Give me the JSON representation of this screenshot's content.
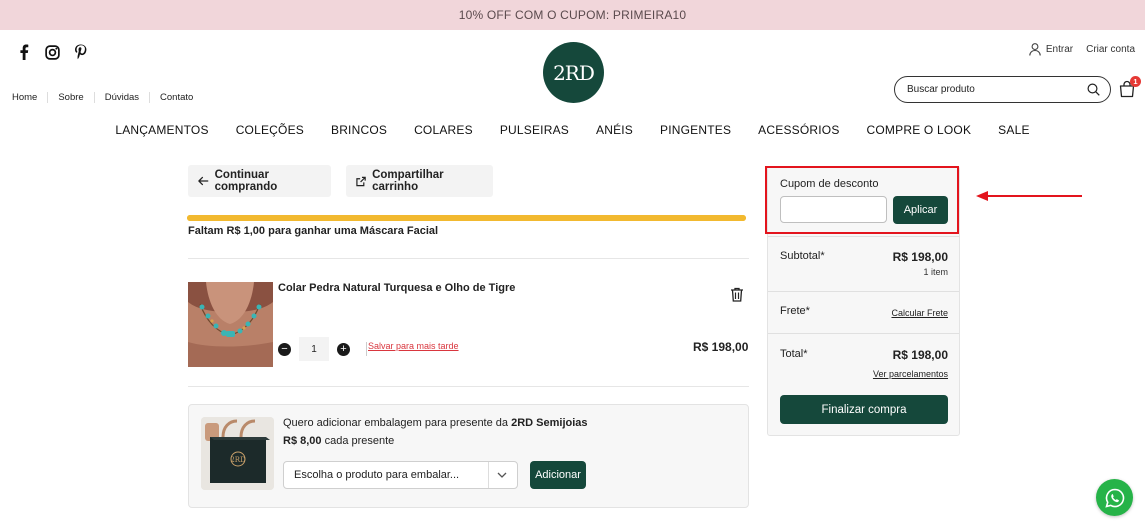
{
  "promo": {
    "text": "10% OFF COM O CUPOM: PRIMEIRA10"
  },
  "social": {
    "icons": [
      "facebook-icon",
      "instagram-icon",
      "pinterest-icon"
    ]
  },
  "brand": {
    "logo_text": "2RD"
  },
  "account": {
    "login_label": "Entrar",
    "signup_label": "Criar conta"
  },
  "topnav": {
    "items": [
      "Home",
      "Sobre",
      "Dúvidas",
      "Contato"
    ]
  },
  "search": {
    "placeholder": "Buscar produto"
  },
  "cart": {
    "count": "1"
  },
  "mainnav": {
    "items": [
      "LANÇAMENTOS",
      "COLEÇÕES",
      "BRINCOS",
      "COLARES",
      "PULSEIRAS",
      "ANÉIS",
      "PINGENTES",
      "ACESSÓRIOS",
      "COMPRE O LOOK",
      "SALE"
    ]
  },
  "actions": {
    "continue_label": "Continuar comprando",
    "share_label": "Compartilhar carrinho"
  },
  "shipping_progress": {
    "percent": 100,
    "message": "Faltam R$ 1,00 para ganhar uma Máscara Facial"
  },
  "cart_item": {
    "name": "Colar Pedra Natural Turquesa e Olho de Tigre",
    "quantity": "1",
    "save_later": "Salvar para mais tarde",
    "price": "R$ 198,00"
  },
  "gift": {
    "text_prefix": "Quero adicionar embalagem para presente da ",
    "brand": "2RD Semijoias",
    "price": "R$ 8,00",
    "price_suffix": " cada presente",
    "select_value": "Escolha o produto para embalar...",
    "add_label": "Adicionar"
  },
  "summary": {
    "coupon_label": "Cupom de desconto",
    "coupon_value": "",
    "apply_label": "Aplicar",
    "subtotal_label": "Subtotal*",
    "subtotal_value": "R$ 198,00",
    "items_count": "1 item",
    "shipping_label": "Frete*",
    "shipping_link": "Calcular Frete",
    "total_label": "Total*",
    "total_value": "R$ 198,00",
    "installments_link": "Ver parcelamentos",
    "checkout_label": "Finalizar compra"
  },
  "colors": {
    "brand_green": "#15483b",
    "promo_bg": "#f1d6da",
    "highlight_red": "#e3141d",
    "progress_yellow": "#f2b92f",
    "whatsapp_green": "#26b348"
  }
}
